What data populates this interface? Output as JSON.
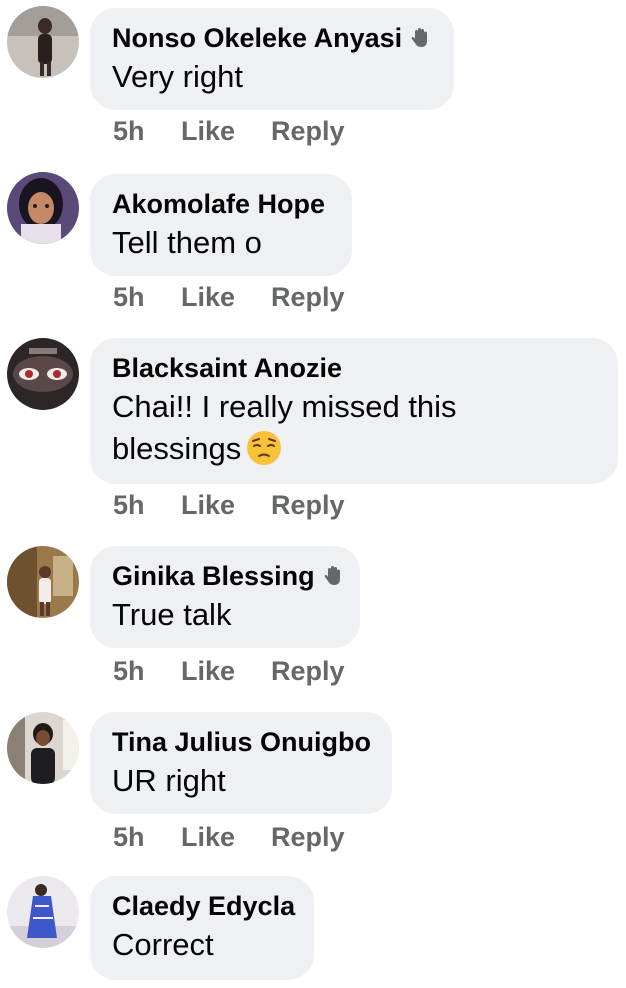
{
  "comments": [
    {
      "author": "Nonso Okeleke Anyasi",
      "wave": true,
      "text": "Very right",
      "time": "5h",
      "like": "Like",
      "reply": "Reply",
      "avatar_bg": "#b9b2ad",
      "avatar_fg": "#3a2a2a"
    },
    {
      "author": "Akomolafe Hope",
      "wave": false,
      "text": "Tell them o",
      "time": "5h",
      "like": "Like",
      "reply": "Reply",
      "avatar_bg": "#4b3a6e",
      "avatar_fg": "#c98a6a"
    },
    {
      "author": "Blacksaint Anozie",
      "wave": false,
      "text": "Chai!! I really missed this blessings",
      "emoji": "pensive-face-emoji",
      "time": "5h",
      "like": "Like",
      "reply": "Reply",
      "avatar_bg": "#3a3030",
      "avatar_fg": "#b03030"
    },
    {
      "author": "Ginika Blessing",
      "wave": true,
      "text": "True talk",
      "time": "5h",
      "like": "Like",
      "reply": "Reply",
      "avatar_bg": "#8a6a3a",
      "avatar_fg": "#f0e8dd"
    },
    {
      "author": "Tina Julius Onuigbo",
      "wave": false,
      "text": "UR right",
      "time": "5h",
      "like": "Like",
      "reply": "Reply",
      "avatar_bg": "#d8d0c8",
      "avatar_fg": "#2a2a2a"
    },
    {
      "author": "Claedy Edycla",
      "wave": false,
      "text": "Correct",
      "avatar_bg": "#e8e6ea",
      "avatar_fg": "#3a52c8"
    }
  ],
  "colors": {
    "bubble": "#eef0f3",
    "meta": "#65676b",
    "text": "#050505"
  }
}
